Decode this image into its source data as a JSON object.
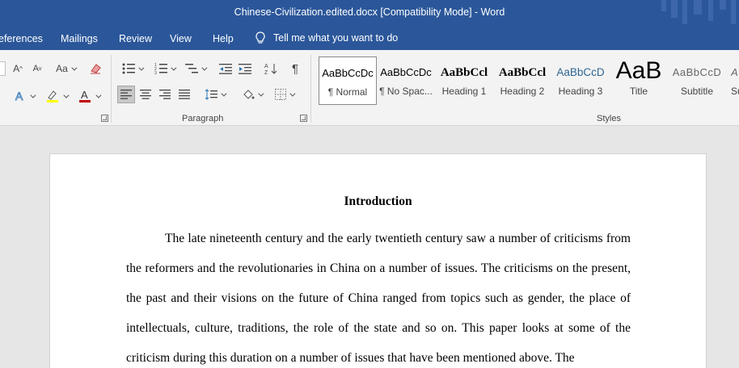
{
  "window": {
    "title": "Chinese-Civilization.edited.docx [Compatibility Mode]  -  Word"
  },
  "menu": {
    "items": [
      {
        "label": "eferences"
      },
      {
        "label": "Mailings"
      },
      {
        "label": "Review"
      },
      {
        "label": "View"
      },
      {
        "label": "Help"
      }
    ],
    "tell_me": "Tell me what you want to do"
  },
  "ribbon": {
    "groups": {
      "paragraph": "Paragraph",
      "styles": "Styles"
    },
    "font_case_glyph": "Aa",
    "styles": [
      {
        "preview": "AaBbCcDc",
        "name": "¶ Normal",
        "selected": true
      },
      {
        "preview": "AaBbCcDc",
        "name": "¶ No Spac..."
      },
      {
        "preview": "AaBbCcl",
        "name": "Heading 1"
      },
      {
        "preview": "AaBbCcl",
        "name": "Heading 2"
      },
      {
        "preview": "AaBbCcD",
        "name": "Heading 3"
      },
      {
        "preview": "AaB",
        "name": "Title"
      },
      {
        "preview": "AaBbCcD",
        "name": "Subtitle"
      },
      {
        "preview": "A",
        "name": "Su"
      }
    ]
  },
  "document": {
    "heading": "Introduction",
    "paragraph": "The late nineteenth century and the early twentieth century saw a number of criticisms from the reformers and the revolutionaries in China on a number of issues. The criticisms on the present, the past and their visions on the future of China ranged from topics such as gender, the place of intellectuals, culture, traditions, the role of the state and so on. This paper looks at some of the criticism during this duration on a number of issues that have been mentioned above. The"
  },
  "colors": {
    "title_bar": "#2b579a",
    "ribbon": "#f3f3f3",
    "canvas": "#e6e6e6",
    "highlight": "#ffff00",
    "font_color": "#c00000"
  }
}
